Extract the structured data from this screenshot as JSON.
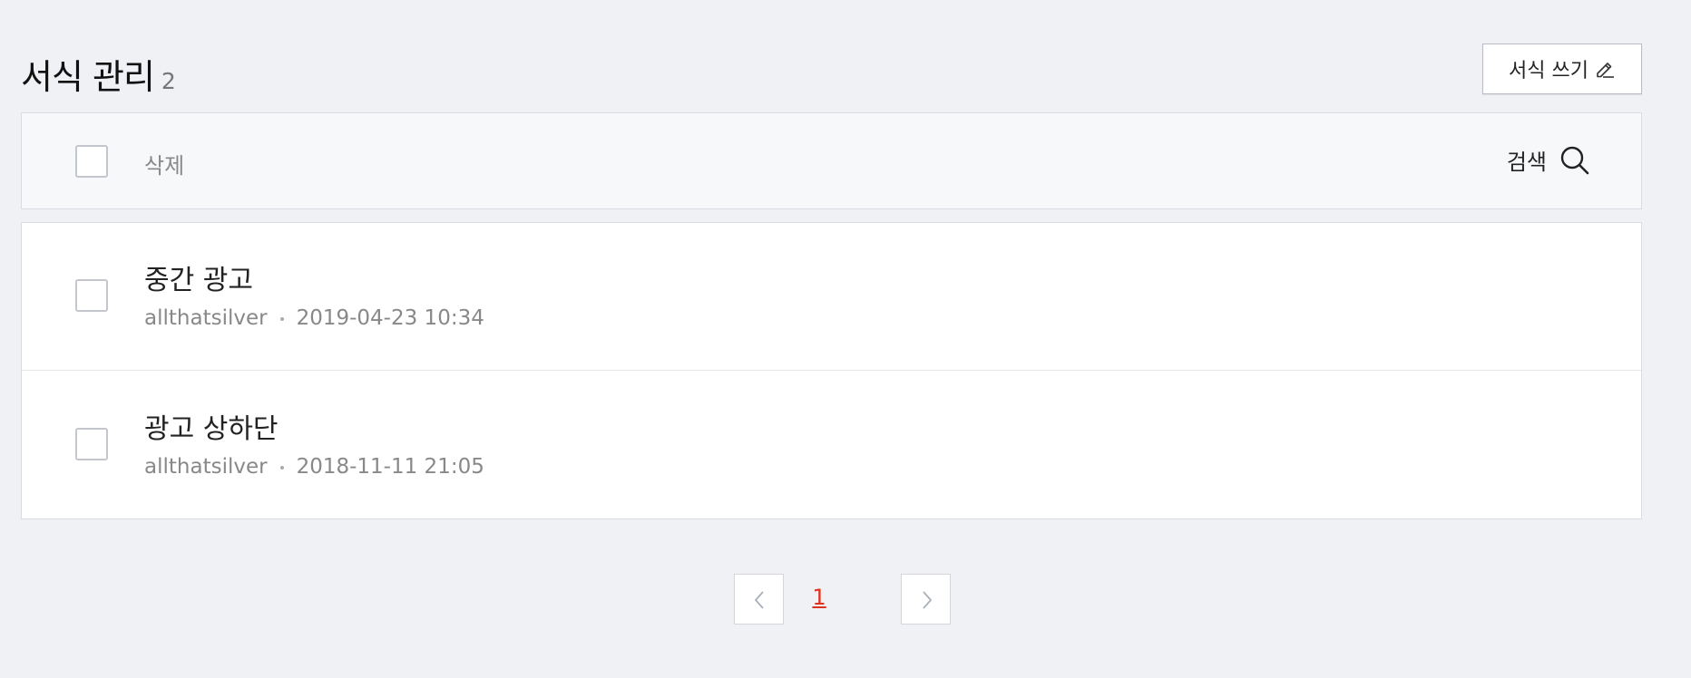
{
  "header": {
    "title": "서식 관리",
    "count": "2",
    "write_button_label": "서식 쓰기"
  },
  "toolbar": {
    "delete_label": "삭제",
    "search_label": "검색"
  },
  "rows": [
    {
      "title": "중간 광고",
      "author": "allthatsilver",
      "date": "2019-04-23 10:34"
    },
    {
      "title": "광고 상하단",
      "author": "allthatsilver",
      "date": "2018-11-11 21:05"
    }
  ],
  "pagination": {
    "current_page": "1"
  },
  "colors": {
    "accent_page": "#e0301e",
    "background": "#f0f1f5"
  }
}
